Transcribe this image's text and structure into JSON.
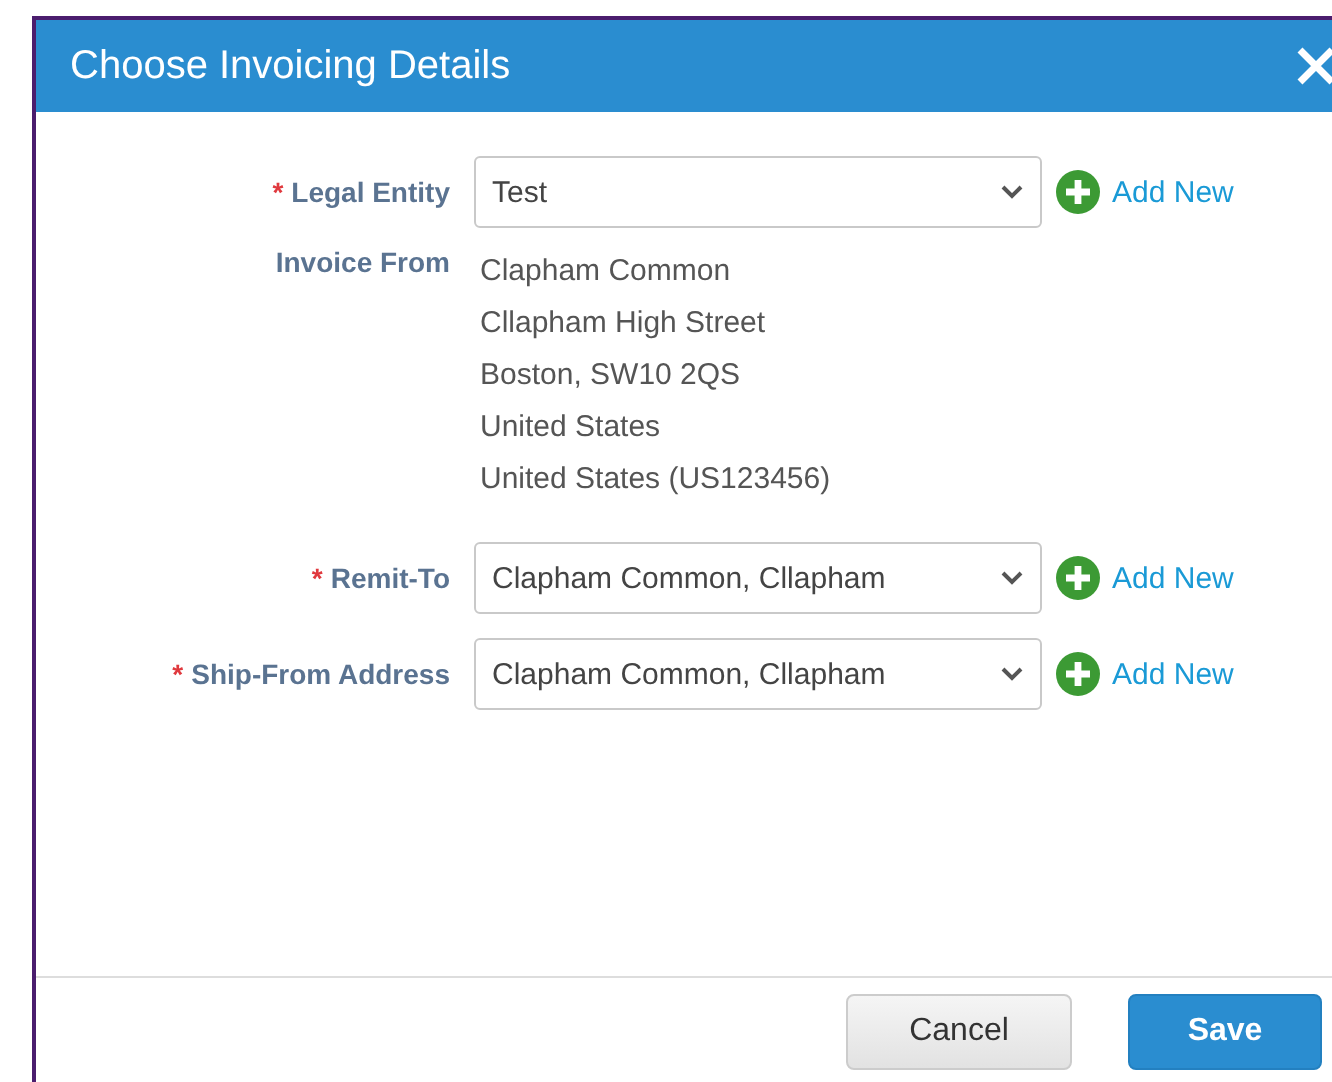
{
  "dialog": {
    "title": "Choose Invoicing Details"
  },
  "fields": [
    {
      "kind": "select",
      "label": "Legal Entity",
      "marker": "*",
      "value": "Test",
      "action": "Add New"
    },
    {
      "kind": "address",
      "label": "Invoice From",
      "lines": [
        "Clapham Common",
        "Cllapham High Street",
        "Boston, SW10 2QS",
        "United States",
        "United States (US123456)"
      ]
    },
    {
      "kind": "select",
      "label": "Remit-To",
      "marker": "*",
      "value": "Clapham Common, Cllapham",
      "action": "Add New"
    },
    {
      "kind": "select",
      "label": "Ship-From Address",
      "marker": "*",
      "value": "Clapham Common, Cllapham",
      "action": "Add New"
    }
  ],
  "buttons": [
    {
      "label": "Cancel",
      "primary": false
    },
    {
      "label": "Save",
      "primary": true
    }
  ]
}
